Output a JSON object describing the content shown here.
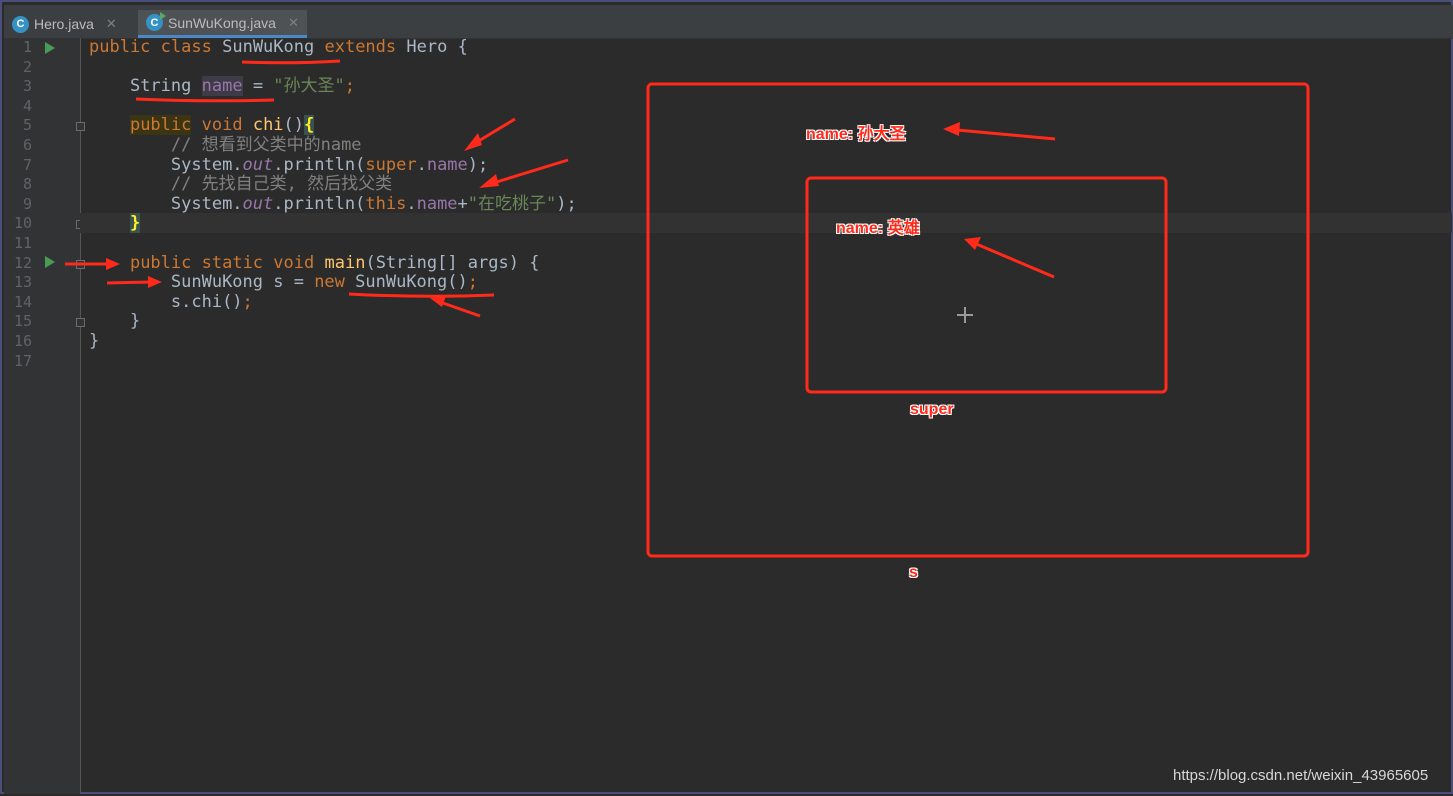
{
  "tabs": [
    {
      "label": "Hero.java",
      "icon": "class-icon",
      "icon_letter": "C",
      "active": false
    },
    {
      "label": "SunWuKong.java",
      "icon": "runnable-class-icon",
      "icon_letter": "C",
      "active": true
    }
  ],
  "close_glyph": "✕",
  "line_numbers": [
    "1",
    "2",
    "3",
    "4",
    "5",
    "6",
    "7",
    "8",
    "9",
    "10",
    "11",
    "12",
    "13",
    "14",
    "15",
    "16",
    "17"
  ],
  "code": {
    "l1": {
      "kw1": "public",
      "kw2": "class",
      "cls": "SunWuKong",
      "kw3": "extends",
      "rest": "Hero {"
    },
    "l3": {
      "type": "String",
      "var": "name",
      "eq": " = ",
      "val": "\"孙大圣\"",
      "semi": ";"
    },
    "l5": {
      "kw1": "public",
      "kw2": "void",
      "fn": "chi",
      "paren": "()",
      "brace": "{"
    },
    "l6": "// 想看到父类中的name",
    "l7": {
      "a": "System.",
      "out": "out",
      "b": ".println(",
      "kw": "super",
      "dot": ".",
      "fld": "name",
      "end": ");"
    },
    "l8": "// 先找自己类, 然后找父类",
    "l9": {
      "a": "System.",
      "out": "out",
      "b": ".println(",
      "kw": "this",
      "dot": ".",
      "fld": "name",
      "plus": "+",
      "str": "\"在吃桃子\"",
      "end": ");"
    },
    "l10": "}",
    "l12": {
      "kw1": "public",
      "kw2": "static",
      "kw3": "void",
      "fn": "main",
      "rest": "(String[] args) {"
    },
    "l13": {
      "a": "SunWuKong s = ",
      "kw": "new",
      "b": " SunWuKong()",
      "semi": ";"
    },
    "l14": {
      "a": "s.chi()",
      "semi": ";"
    },
    "l15": "}",
    "l16": "}"
  },
  "annotations": {
    "outer_field": "name: 孙大圣",
    "inner_field": "name: 英雄",
    "inner_box_label": "super",
    "outer_box_label": "s",
    "annotation_color": "#ff2a1a"
  },
  "watermark": "https://blog.csdn.net/weixin_43965605",
  "colors": {
    "background": "#2b2b2b",
    "keyword": "#cc7832",
    "string": "#6a8759",
    "field": "#9876aa",
    "method": "#ffc66d",
    "comment": "#808080"
  }
}
